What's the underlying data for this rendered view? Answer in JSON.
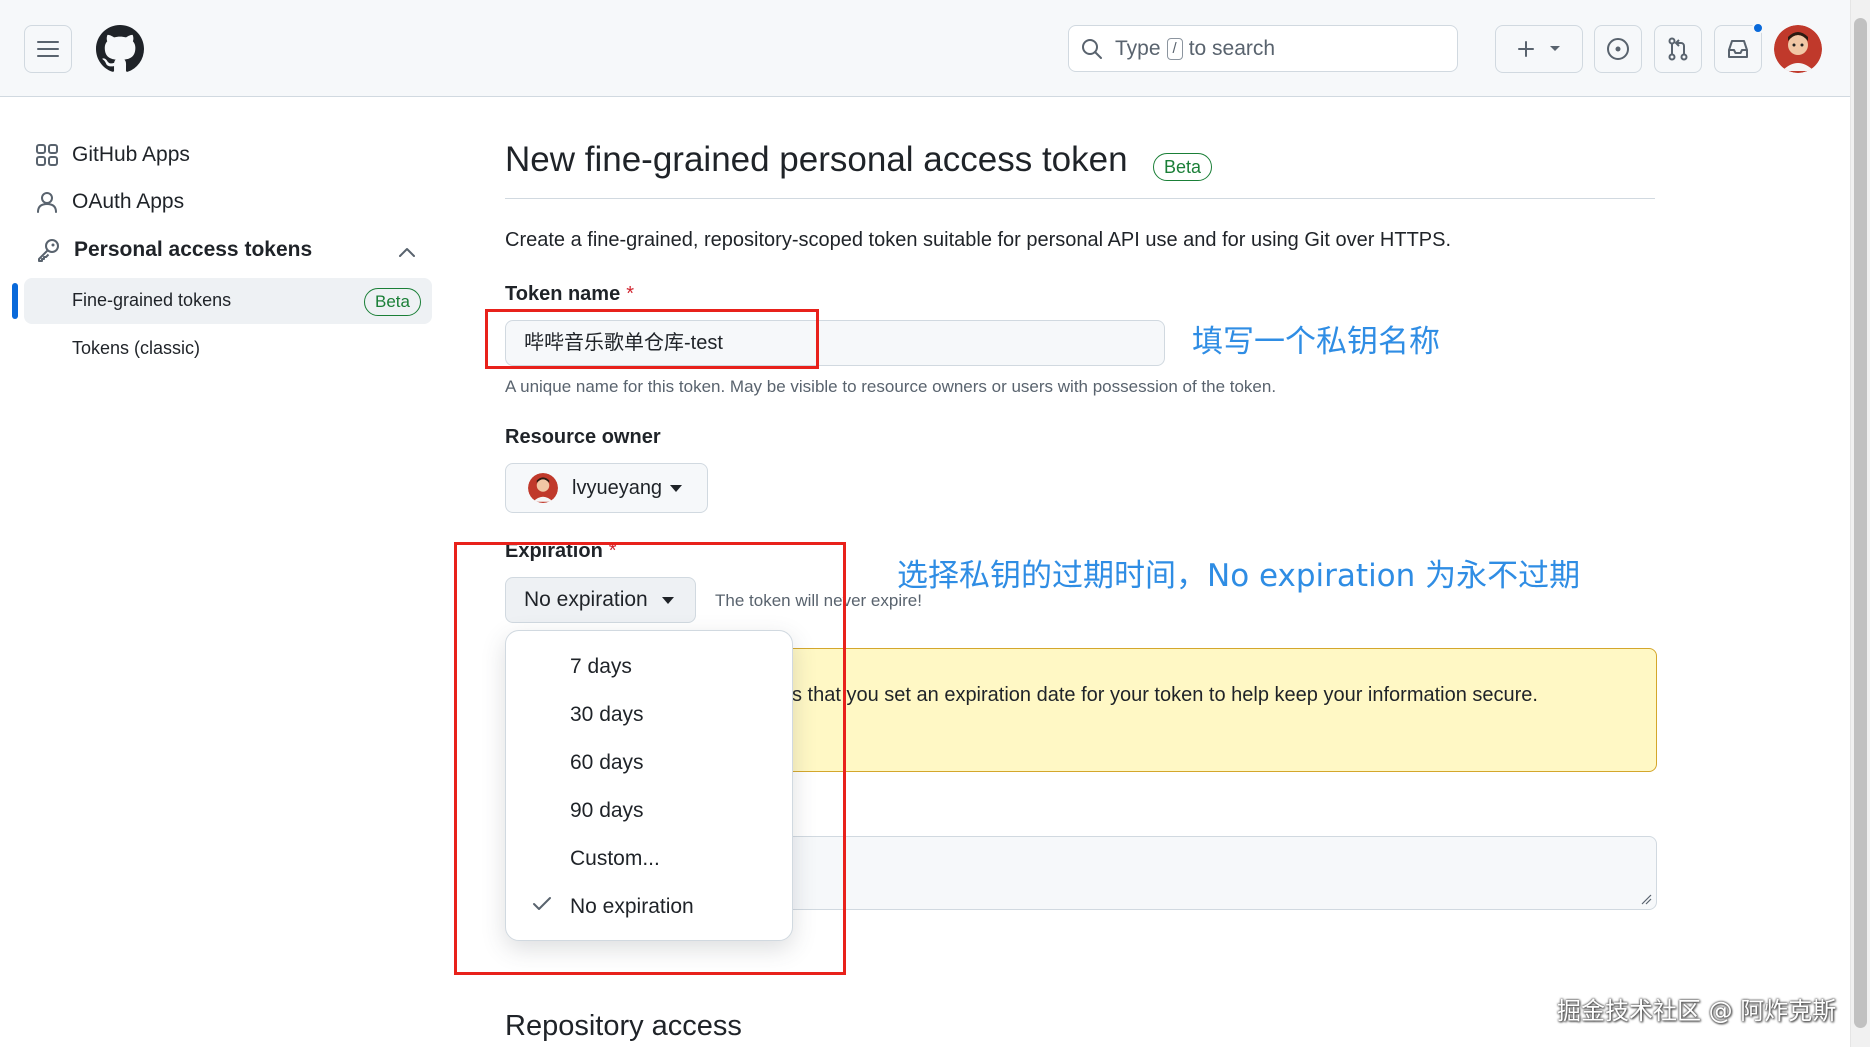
{
  "header": {
    "search": {
      "prefix": "Type",
      "kbd": "/",
      "suffix": "to search"
    }
  },
  "sidebar": {
    "items": [
      {
        "label": "GitHub Apps"
      },
      {
        "label": "OAuth Apps"
      },
      {
        "label": "Personal access tokens"
      }
    ],
    "sub_items": [
      {
        "label": "Fine-grained tokens",
        "badge": "Beta"
      },
      {
        "label": "Tokens (classic)"
      }
    ]
  },
  "main": {
    "title": "New fine-grained personal access token",
    "title_badge": "Beta",
    "description": "Create a fine-grained, repository-scoped token suitable for personal API use and for using Git over HTTPS.",
    "token_name": {
      "label": "Token name",
      "required": "*",
      "value": "哔哔音乐歌单仓库-test",
      "hint": "A unique name for this token. May be visible to resource owners or users with possession of the token."
    },
    "resource_owner": {
      "label": "Resource owner",
      "value": "lvyueyang"
    },
    "expiration": {
      "label": "Expiration",
      "required": "*",
      "selected": "No expiration",
      "note": "The token will never expire!",
      "options": [
        "7 days",
        "30 days",
        "60 days",
        "90 days",
        "Custom...",
        "No expiration"
      ]
    },
    "warning_text": "s that you set an expiration date for your token to help keep your information secure.",
    "repository_access_heading": "Repository access"
  },
  "annotations": {
    "note1": "填写一个私钥名称",
    "note2": "选择私钥的过期时间，No expiration 为永不过期"
  },
  "watermark": "掘金技术社区 @ 阿炸克斯",
  "colors": {
    "accent": "#0969da",
    "success": "#1a7f37",
    "danger": "#d1242f",
    "annotation_red": "#e8211b",
    "annotation_blue": "#2f8de4",
    "warning_bg": "#fff8c5"
  }
}
